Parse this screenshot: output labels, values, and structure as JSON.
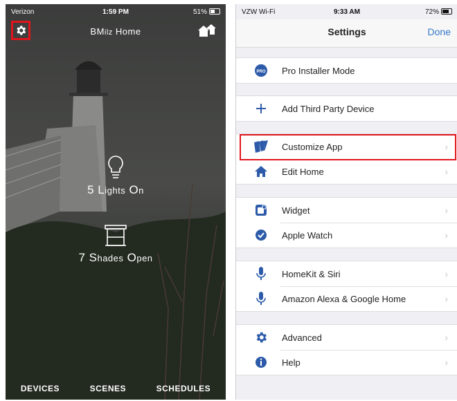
{
  "left": {
    "status": {
      "carrier": "Verizon",
      "time": "1:59 PM",
      "battery": "51%"
    },
    "title_first": "BM",
    "title_sc": "ilz",
    "title_rest": " Home",
    "tiles": [
      {
        "num": "5 ",
        "cap1": "L",
        "sc1": "ights",
        "cap2": " O",
        "sc2": "n"
      },
      {
        "num": "7 ",
        "cap1": "S",
        "sc1": "hades",
        "cap2": " O",
        "sc2": "pen"
      }
    ],
    "tabs": [
      "DEVICES",
      "SCENES",
      "SCHEDULES"
    ]
  },
  "right": {
    "status": {
      "carrier": "VZW Wi-Fi",
      "time": "9:33 AM",
      "battery": "72%"
    },
    "nav": {
      "title": "Settings",
      "done": "Done"
    },
    "groups": [
      {
        "rows": [
          {
            "label": "Pro Installer Mode",
            "icon": "pro-icon",
            "chevron": false
          }
        ]
      },
      {
        "rows": [
          {
            "label": "Add Third Party Device",
            "icon": "plus-icon",
            "chevron": false
          }
        ]
      },
      {
        "rows": [
          {
            "label": "Customize App",
            "icon": "cards-icon",
            "chevron": true
          },
          {
            "label": "Edit Home",
            "icon": "house-icon",
            "chevron": true
          }
        ]
      },
      {
        "rows": [
          {
            "label": "Widget",
            "icon": "widget-icon",
            "chevron": true
          },
          {
            "label": "Apple Watch",
            "icon": "check-circle-icon",
            "chevron": true
          }
        ]
      },
      {
        "rows": [
          {
            "label": "HomeKit & Siri",
            "icon": "microphone-icon",
            "chevron": true
          },
          {
            "label": "Amazon Alexa & Google Home",
            "icon": "microphone-icon",
            "chevron": true
          }
        ]
      },
      {
        "rows": [
          {
            "label": "Advanced",
            "icon": "gear-icon",
            "chevron": true
          },
          {
            "label": "Help",
            "icon": "info-icon",
            "chevron": true
          }
        ]
      }
    ]
  },
  "colors": {
    "accent": "#3678c9",
    "icon_blue": "#2d5ba9",
    "highlight": "#e0141c"
  }
}
